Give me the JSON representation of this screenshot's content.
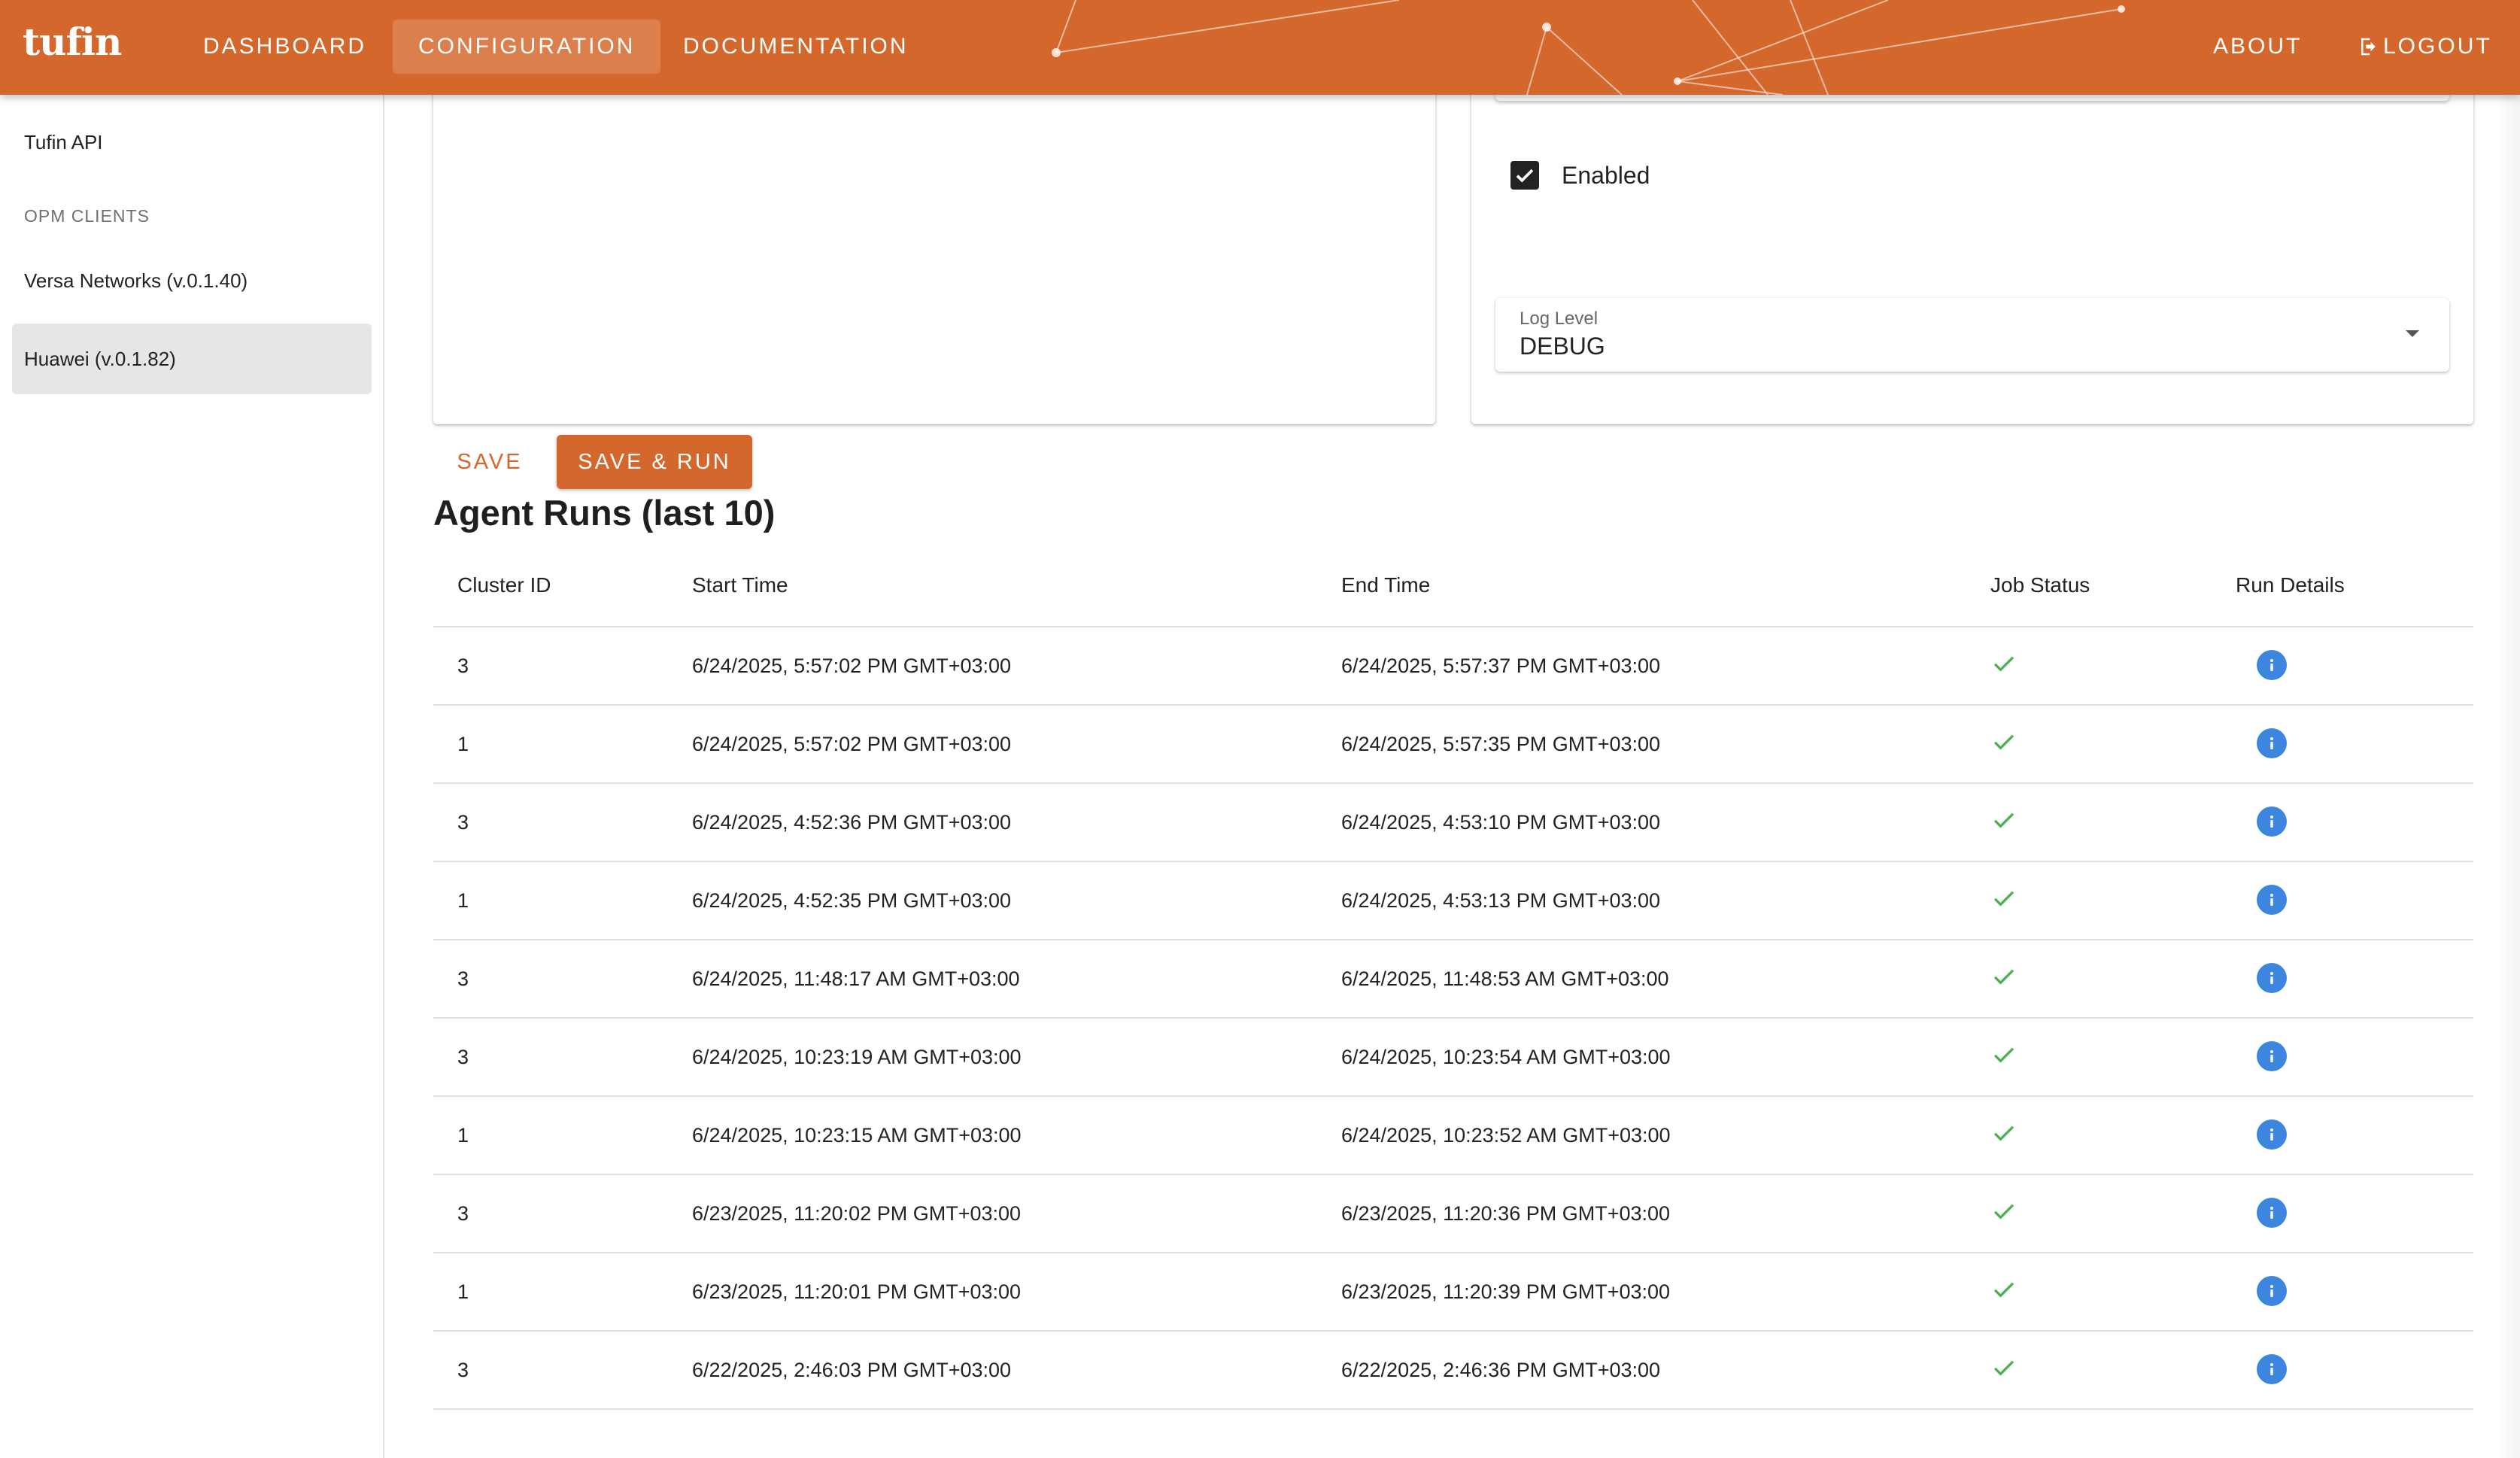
{
  "header": {
    "logo": "tufin",
    "nav": {
      "dashboard": "DASHBOARD",
      "configuration": "CONFIGURATION",
      "documentation": "DOCUMENTATION",
      "about": "ABOUT",
      "logout": "LOGOUT"
    },
    "icons": {
      "logout": "logout-icon"
    },
    "colors": {
      "brand": "#d4672b"
    }
  },
  "sidebar": {
    "tufin_api": "Tufin API",
    "opm_header": "OPM CLIENTS",
    "clients": [
      {
        "label": "Versa Networks (v.0.1.40)",
        "selected": false
      },
      {
        "label": "Huawei (v.0.1.82)",
        "selected": true
      }
    ]
  },
  "config": {
    "enabled_label": "Enabled",
    "enabled": true,
    "log_level_label": "Log Level",
    "log_level_value": "DEBUG",
    "save_label": "SAVE",
    "save_run_label": "SAVE & RUN"
  },
  "runs": {
    "title": "Agent Runs (last 10)",
    "columns": {
      "cluster_id": "Cluster ID",
      "start_time": "Start Time",
      "end_time": "End Time",
      "job_status": "Job Status",
      "run_details": "Run Details"
    },
    "rows": [
      {
        "cluster_id": "3",
        "start": "6/24/2025, 5:57:02 PM GMT+03:00",
        "end": "6/24/2025, 5:57:37 PM GMT+03:00",
        "status": "success"
      },
      {
        "cluster_id": "1",
        "start": "6/24/2025, 5:57:02 PM GMT+03:00",
        "end": "6/24/2025, 5:57:35 PM GMT+03:00",
        "status": "success"
      },
      {
        "cluster_id": "3",
        "start": "6/24/2025, 4:52:36 PM GMT+03:00",
        "end": "6/24/2025, 4:53:10 PM GMT+03:00",
        "status": "success"
      },
      {
        "cluster_id": "1",
        "start": "6/24/2025, 4:52:35 PM GMT+03:00",
        "end": "6/24/2025, 4:53:13 PM GMT+03:00",
        "status": "success"
      },
      {
        "cluster_id": "3",
        "start": "6/24/2025, 11:48:17 AM GMT+03:00",
        "end": "6/24/2025, 11:48:53 AM GMT+03:00",
        "status": "success"
      },
      {
        "cluster_id": "3",
        "start": "6/24/2025, 10:23:19 AM GMT+03:00",
        "end": "6/24/2025, 10:23:54 AM GMT+03:00",
        "status": "success"
      },
      {
        "cluster_id": "1",
        "start": "6/24/2025, 10:23:15 AM GMT+03:00",
        "end": "6/24/2025, 10:23:52 AM GMT+03:00",
        "status": "success"
      },
      {
        "cluster_id": "3",
        "start": "6/23/2025, 11:20:02 PM GMT+03:00",
        "end": "6/23/2025, 11:20:36 PM GMT+03:00",
        "status": "success"
      },
      {
        "cluster_id": "1",
        "start": "6/23/2025, 11:20:01 PM GMT+03:00",
        "end": "6/23/2025, 11:20:39 PM GMT+03:00",
        "status": "success"
      },
      {
        "cluster_id": "3",
        "start": "6/22/2025, 2:46:03 PM GMT+03:00",
        "end": "6/22/2025, 2:46:36 PM GMT+03:00",
        "status": "success"
      }
    ],
    "icons": {
      "status": "check-icon",
      "details": "info-icon"
    },
    "colors": {
      "success": "#4caf50",
      "info": "#3d86e0"
    }
  }
}
